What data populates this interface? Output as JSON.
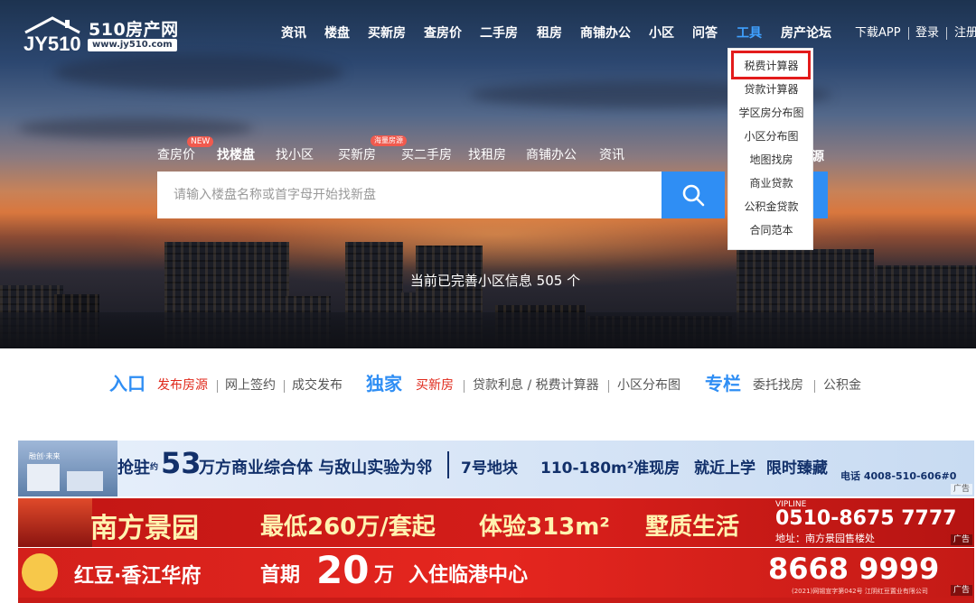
{
  "header": {
    "logo_title": "510房产网",
    "logo_url": "www.jy510.com",
    "nav": [
      "资讯",
      "楼盘",
      "买新房",
      "查房价",
      "二手房",
      "租房",
      "商铺办公",
      "小区",
      "问答",
      "工具",
      "房产论坛"
    ],
    "active_nav": "工具",
    "user_links": [
      "下载APP",
      "登录",
      "注册"
    ]
  },
  "dropdown": {
    "items": [
      "税费计算器",
      "贷款计算器",
      "学区房分布图",
      "小区分布图",
      "地图找房",
      "商业贷款",
      "公积金贷款",
      "合同范本"
    ],
    "highlighted": "税费计算器"
  },
  "search": {
    "tabs": [
      "查房价",
      "找楼盘",
      "找小区",
      "买新房",
      "买二手房",
      "找租房",
      "商铺办公",
      "资讯"
    ],
    "active_tab": "找楼盘",
    "badges": {
      "new": "NEW",
      "hot": "海量房源"
    },
    "tab_tail": "源",
    "placeholder": "请输入楼盘名称或首字母开始找新盘",
    "stat": "当前已完善小区信息 505 个"
  },
  "entries": {
    "rukou": {
      "title": "入口",
      "links": [
        "发布房源",
        "网上签约",
        "成交发布"
      ]
    },
    "dujia": {
      "title": "独家",
      "links": [
        "买新房",
        "贷款利息 / 税费计算器",
        "小区分布图"
      ]
    },
    "zhuanlan": {
      "title": "专栏",
      "links": [
        "委托找房",
        "公积金"
      ]
    }
  },
  "banners": {
    "b1": {
      "brand": "融创·未来",
      "headline": "抢驻",
      "head_sub": "约",
      "big_num": "53",
      "rest": "万方商业综合体 与敌山实验为邻",
      "plot": "7号地块",
      "area": "110-180m²准现房",
      "slogan": "就近上学  限时臻藏",
      "phone": "电话 4008-510-606#0",
      "ad": "广告"
    },
    "b2": {
      "name": "南方景园",
      "headline": "最低260万/套起",
      "expr": "体验313m²",
      "tail": "墅质生活",
      "vip": "VIPLINE",
      "phone": "0510-8675 7777",
      "addr": "地址：南方景园售楼处",
      "ad": "广告"
    },
    "b3": {
      "name": "红豆·香江华府",
      "first": "首期",
      "num": "20",
      "wan": "万",
      "tail": "入住临港中心",
      "phone": "8668 9999",
      "note": "(2021)网锡宣字第042号  江阴红豆置业有限公司",
      "ad": "广告"
    }
  },
  "colors": {
    "accent": "#2f8ef4",
    "red": "#e02a1c",
    "highlight_box": "#e31b1b"
  }
}
